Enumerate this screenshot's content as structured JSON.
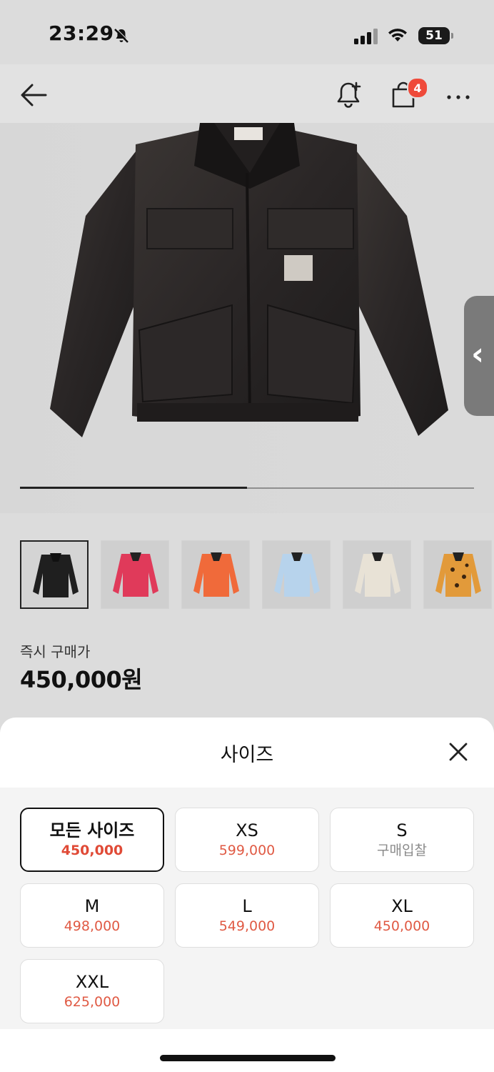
{
  "status": {
    "time": "23:29",
    "battery": "51"
  },
  "header": {
    "cart_count": "4"
  },
  "product": {
    "price_label": "즉시 구매가",
    "price_value": "450,000원",
    "thumbnail_colors": [
      "#1f1f1f",
      "#e03a5a",
      "#f06a3a",
      "#b7d3ec",
      "#e8e2d6",
      "#e29a3a"
    ]
  },
  "image_carousel": {
    "progress": 0.5
  },
  "sheet": {
    "title": "사이즈",
    "options": [
      {
        "size": "모든 사이즈",
        "price": "450,000"
      },
      {
        "size": "XS",
        "price": "599,000"
      },
      {
        "size": "S",
        "price": "구매입찰"
      },
      {
        "size": "M",
        "price": "498,000"
      },
      {
        "size": "L",
        "price": "549,000"
      },
      {
        "size": "XL",
        "price": "450,000"
      },
      {
        "size": "XXL",
        "price": "625,000"
      }
    ]
  }
}
